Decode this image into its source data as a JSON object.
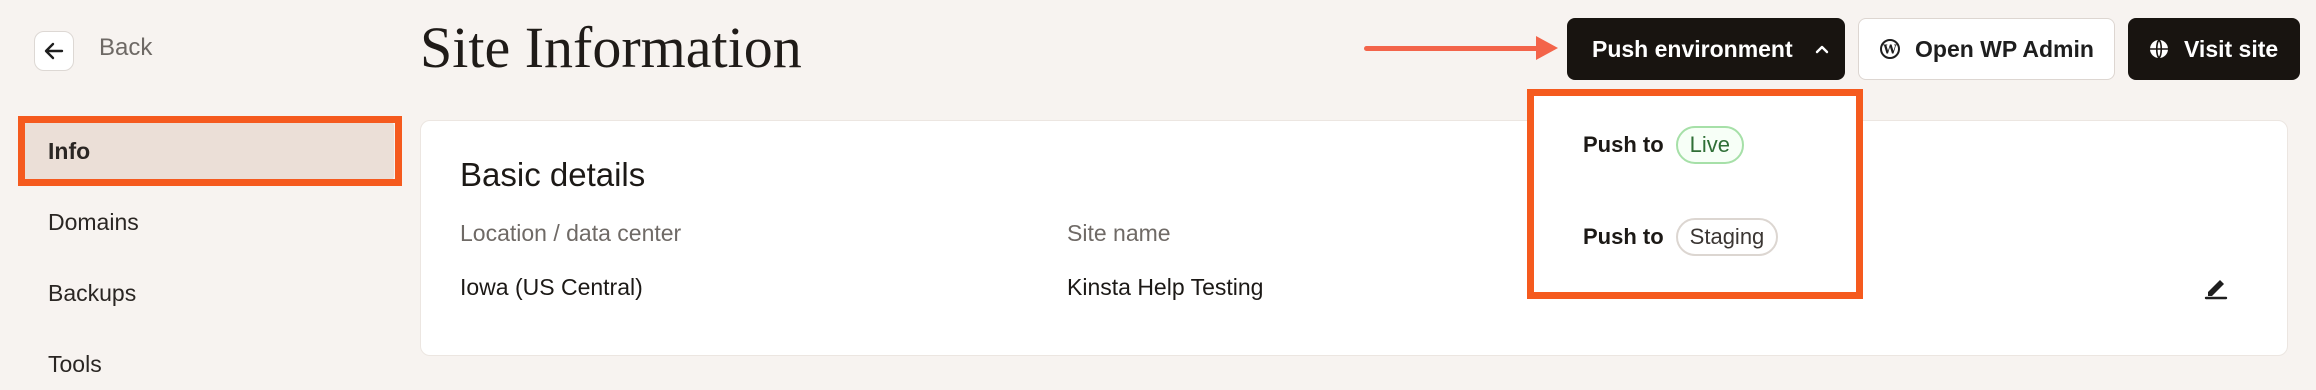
{
  "nav": {
    "back_label": "Back"
  },
  "sidebar": {
    "items": [
      {
        "label": "Info",
        "active": true
      },
      {
        "label": "Domains"
      },
      {
        "label": "Backups"
      },
      {
        "label": "Tools"
      }
    ]
  },
  "header": {
    "title": "Site Information",
    "push_button": "Push environment",
    "wp_admin_button": "Open WP Admin",
    "visit_button": "Visit site"
  },
  "dropdown": {
    "items": [
      {
        "prefix": "Push to",
        "target": "Live"
      },
      {
        "prefix": "Push to",
        "target": "Staging"
      }
    ]
  },
  "card": {
    "title": "Basic details",
    "location_label": "Location / data center",
    "location_value": "Iowa (US Central)",
    "site_name_label": "Site name",
    "site_name_value": "Kinsta Help Testing"
  },
  "colors": {
    "highlight": "#f55a1e",
    "arrow": "#f3644a",
    "dark_button": "#181410",
    "active_nav": "#ebdfd7",
    "page_bg": "#f7f3f0"
  },
  "icons": [
    "arrow-left-icon",
    "chevron-up-icon",
    "wordpress-icon",
    "globe-icon",
    "edit-pencil-icon"
  ]
}
